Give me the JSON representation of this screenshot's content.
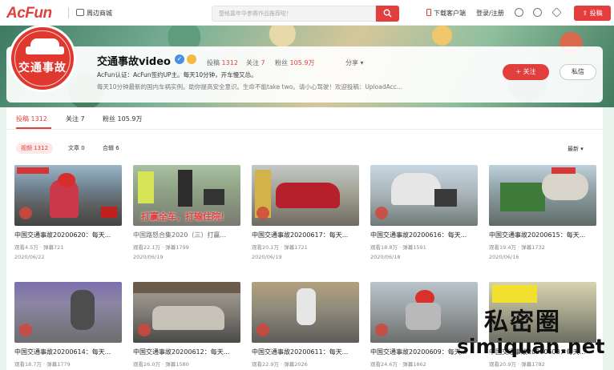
{
  "nav": {
    "logo": "AcFun",
    "shop": "周边商城",
    "search_placeholder": "楚格嘉年华参赛作品推荐啦！",
    "download": "下载客户端",
    "login": "登录/注册",
    "upload": "投稿"
  },
  "profile": {
    "avatar_text": "交通事故",
    "name": "交通事故video",
    "stats": [
      {
        "label": "投稿",
        "value": "1312"
      },
      {
        "label": "关注",
        "value": "7"
      },
      {
        "label": "粉丝",
        "value": "105.9万"
      }
    ],
    "share": "分享",
    "cert": "AcFun认证：AcFun签约UP主。每天10分钟，开车慢又怂。",
    "desc": "每天10分钟最新的国内车祸实例。助你提高安全意识。生命不能take two。请小心驾驶！欢迎投稿：UploadAcc...",
    "follow": "+ 关注",
    "message": "私信"
  },
  "tabs": [
    "投稿 1312",
    "关注 7",
    "粉丝 105.9万"
  ],
  "filters": [
    "视频 1312",
    "文章 0",
    "合辑 6"
  ],
  "sort": "最新",
  "videos": [
    {
      "title": "中国交通事故20200620：每天...",
      "views": "观看4.5万",
      "danmu": "弹幕721",
      "date": "2020/06/22",
      "dim": false
    },
    {
      "title": "中国路怒合集2020（三）打赢...",
      "views": "观看22.1万",
      "danmu": "弹幕1799",
      "date": "2020/06/19",
      "dim": true,
      "overlay": "打赢全车，打输住院！"
    },
    {
      "title": "中国交通事故20200617：每天...",
      "views": "观看20.1万",
      "danmu": "弹幕1721",
      "date": "2020/06/19",
      "dim": false
    },
    {
      "title": "中国交通事故20200616：每天...",
      "views": "观看18.8万",
      "danmu": "弹幕1591",
      "date": "2020/06/18",
      "dim": false
    },
    {
      "title": "中国交通事故20200615：每天...",
      "views": "观看19.4万",
      "danmu": "弹幕1732",
      "date": "2020/06/16",
      "dim": false
    },
    {
      "title": "中国交通事故20200614：每天...",
      "views": "观看18.7万",
      "danmu": "弹幕1779",
      "date": "",
      "dim": false
    },
    {
      "title": "中国交通事故20200612：每天...",
      "views": "观看26.0万",
      "danmu": "弹幕1580",
      "date": "",
      "dim": false
    },
    {
      "title": "中国交通事故20200611：每天...",
      "views": "观看22.9万",
      "danmu": "弹幕2026",
      "date": "",
      "dim": false
    },
    {
      "title": "中国交通事故20200609：每天...",
      "views": "观看24.6万",
      "danmu": "弹幕1862",
      "date": "",
      "dim": false
    },
    {
      "title": "中国交通事故20200608：每天...",
      "views": "观看20.9万",
      "danmu": "弹幕1782",
      "date": "",
      "dim": false
    }
  ],
  "watermark": {
    "line1": "私密圈",
    "line2": "simiquan.net"
  }
}
